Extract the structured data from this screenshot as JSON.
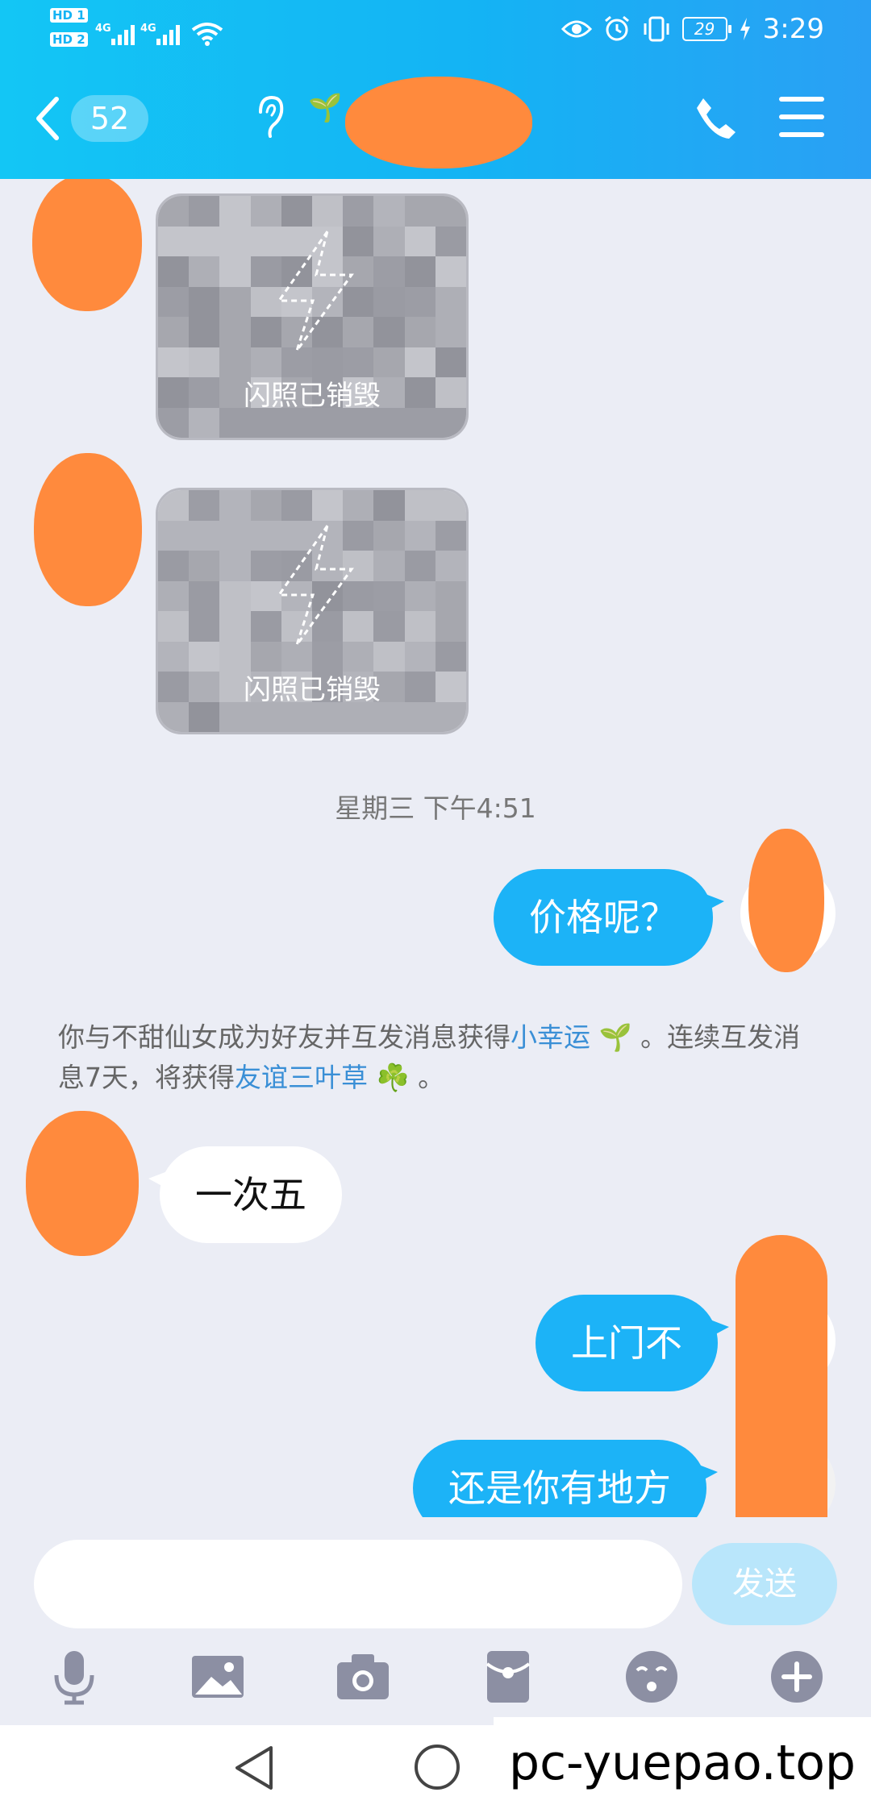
{
  "status_bar": {
    "sim1": "HD 1",
    "sim2": "HD 2",
    "network1": "4G",
    "network2": "4G",
    "battery": "29",
    "time": "3:29"
  },
  "header": {
    "unread_count": "52",
    "contact_name": "",
    "icons": [
      "back-chevron-icon",
      "ear-icon",
      "sprout-icon",
      "phone-icon",
      "menu-icon"
    ]
  },
  "messages": [
    {
      "type": "flash_photo",
      "direction": "in",
      "label": "闪照已销毁"
    },
    {
      "type": "flash_photo",
      "direction": "in",
      "label": "闪照已销毁"
    },
    {
      "type": "timestamp",
      "text": "星期三 下午4:51"
    },
    {
      "type": "text",
      "direction": "out",
      "text": "价格呢？"
    },
    {
      "type": "system",
      "parts": [
        "你与不甜仙女成为好友并互发消息获得",
        "小幸运",
        "。连续互发消息7天，将获得",
        "友谊三叶草",
        "。"
      ]
    },
    {
      "type": "text",
      "direction": "in",
      "text": "一次五"
    },
    {
      "type": "text",
      "direction": "out",
      "text": "上门不"
    },
    {
      "type": "text",
      "direction": "out",
      "text": "还是你有地方"
    }
  ],
  "input": {
    "value": "",
    "placeholder": "",
    "send_label": "发送"
  },
  "toolbar": [
    "microphone-icon",
    "image-icon",
    "camera-icon",
    "red-packet-icon",
    "emoji-icon",
    "plus-icon"
  ],
  "colors": {
    "accent": "#14b3f4",
    "bubble_out": "#1cb3f7",
    "background": "#ebedf5",
    "redaction": "#ff8a3d"
  },
  "watermark": "pc-yuepao.top"
}
